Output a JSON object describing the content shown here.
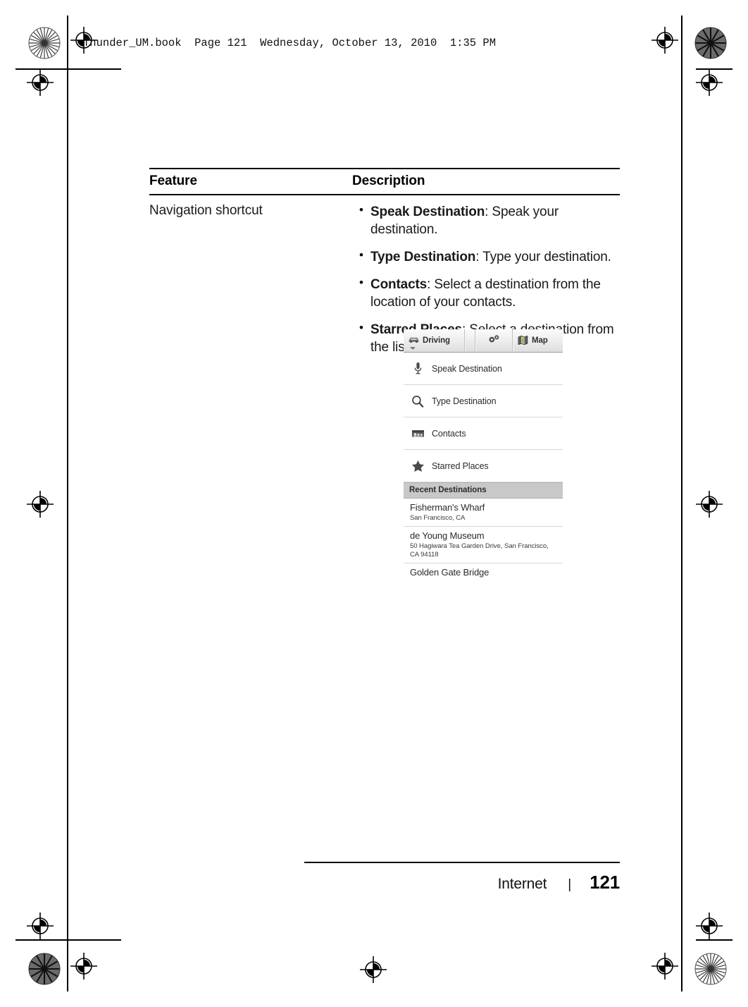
{
  "print": {
    "header_line": "Thunder_UM.book  Page 121  Wednesday, October 13, 2010  1:35 PM"
  },
  "table": {
    "headers": {
      "feature": "Feature",
      "description": "Description"
    },
    "rows": [
      {
        "feature": "Navigation shortcut",
        "bullets": [
          {
            "term": "Speak Destination",
            "text": ": Speak your destination."
          },
          {
            "term": "Type Destination",
            "text": ": Type your destination."
          },
          {
            "term": "Contacts",
            "text": ": Select a destination from the location of your contacts."
          },
          {
            "term": "Starred Places",
            "text": ": Select a destination from the list of Starred Places."
          }
        ]
      }
    ]
  },
  "screenshot": {
    "toolbar": {
      "mode_label": "Driving",
      "mode_icon": "car-icon",
      "dropdown_icon": "caret-down-icon",
      "settings_icon": "gears-icon",
      "map_label": "Map",
      "map_icon": "folded-map-icon"
    },
    "actions": [
      {
        "icon": "microphone-icon",
        "label": "Speak Destination"
      },
      {
        "icon": "magnifier-icon",
        "label": "Type Destination"
      },
      {
        "icon": "contacts-icon",
        "label": "Contacts"
      },
      {
        "icon": "star-icon",
        "label": "Starred Places"
      }
    ],
    "section_title": "Recent Destinations",
    "recent": [
      {
        "name": "Fisherman's Wharf",
        "address": "San Francisco, CA"
      },
      {
        "name": "de Young Museum",
        "address": "50 Hagiwara Tea Garden Drive, San Francisco, CA 94118"
      },
      {
        "name": "Golden Gate Bridge",
        "address": ""
      }
    ]
  },
  "footer": {
    "section": "Internet",
    "separator": "|",
    "page_number": "121"
  },
  "colors": {
    "band": "#c8c8c8",
    "toolbar": "#ececeb",
    "rule": "#000000",
    "divider": "#d8d8d8"
  }
}
